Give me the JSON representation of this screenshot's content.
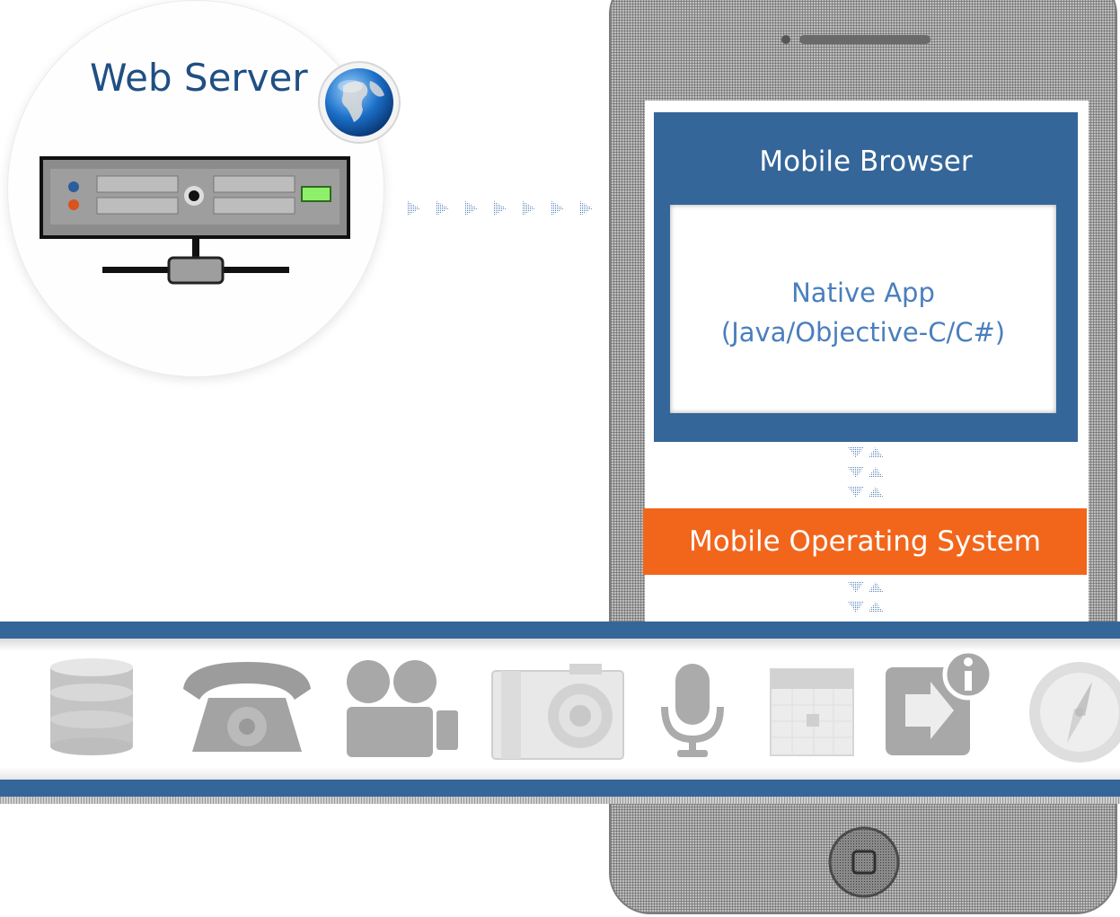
{
  "server": {
    "title": "Web Server"
  },
  "phone": {
    "browser_label": "Mobile Browser",
    "native_app": {
      "line1": "Native App",
      "line2": "(Java/Objective-C/C#)"
    },
    "os_label": "Mobile Operating System"
  },
  "colors": {
    "blue": "#346699",
    "orange": "#f2661c",
    "title_blue": "#1f4f84",
    "native_text": "#4a7fbd",
    "hardware_icon_gray": "#a8a8a8"
  },
  "icons": {
    "server": [
      "globe-icon",
      "server-rack-icon",
      "network-stand-icon"
    ],
    "arrows": [
      "right-arrow-icon",
      "up-down-arrow-icon"
    ],
    "hardware": [
      "database-icon",
      "telephone-icon",
      "video-camera-icon",
      "camera-icon",
      "microphone-icon",
      "calendar-icon",
      "notification-icon",
      "compass-icon"
    ]
  }
}
